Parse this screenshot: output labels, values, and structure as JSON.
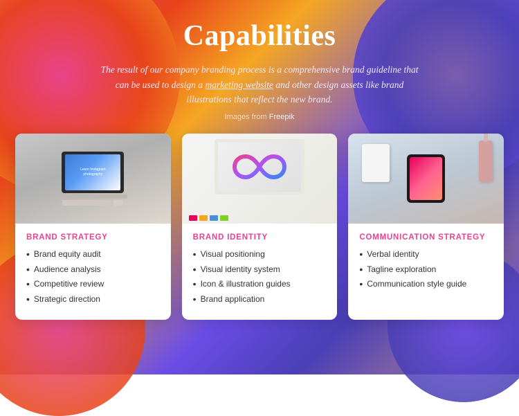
{
  "page": {
    "title": "Capabilities",
    "subtitle": "The result of our company branding process is a comprehensive brand guideline that can be used to design a marketing website and other design assets like brand illustrations that reflect the new brand.",
    "subtitle_link_text": "marketing website",
    "image_credit": "Images from",
    "image_credit_link": "Freepik"
  },
  "cards": [
    {
      "id": "brand-strategy",
      "category": "BRAND STRATEGY",
      "items": [
        "Brand equity audit",
        "Audience analysis",
        "Competitive review",
        "Strategic direction"
      ]
    },
    {
      "id": "brand-identity",
      "category": "BRAND IDENTITY",
      "items": [
        "Visual positioning",
        "Visual identity system",
        "Icon & illustration guides",
        "Brand application"
      ]
    },
    {
      "id": "communication-strategy",
      "category": "COMMUNICATION STRATEGY",
      "items": [
        "Verbal identity",
        "Tagline exploration",
        "Communication style guide"
      ]
    }
  ]
}
